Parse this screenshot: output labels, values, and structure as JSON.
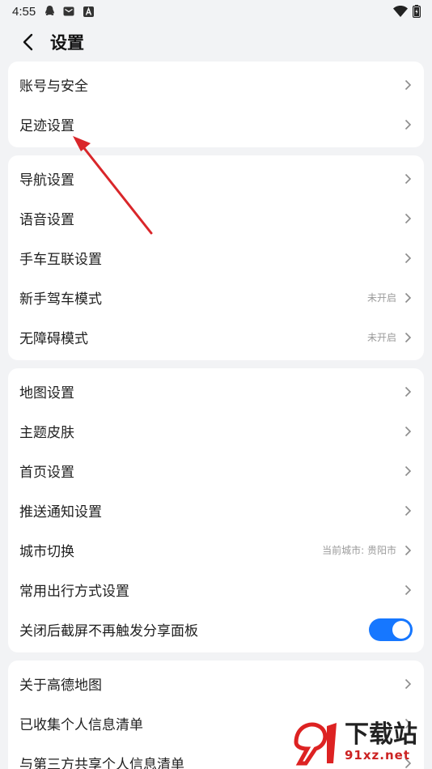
{
  "status_bar": {
    "time": "4:55",
    "icons_left": [
      "qq-icon",
      "mail-icon",
      "a-app-icon"
    ],
    "icons_right": [
      "wifi-icon",
      "battery-icon"
    ]
  },
  "header": {
    "title": "设置"
  },
  "groups": [
    {
      "rows": [
        {
          "label": "账号与安全",
          "value": ""
        },
        {
          "label": "足迹设置",
          "value": ""
        }
      ]
    },
    {
      "rows": [
        {
          "label": "导航设置",
          "value": ""
        },
        {
          "label": "语音设置",
          "value": ""
        },
        {
          "label": "手车互联设置",
          "value": ""
        },
        {
          "label": "新手驾车模式",
          "value": "未开启"
        },
        {
          "label": "无障碍模式",
          "value": "未开启"
        }
      ]
    },
    {
      "rows": [
        {
          "label": "地图设置",
          "value": ""
        },
        {
          "label": "主题皮肤",
          "value": ""
        },
        {
          "label": "首页设置",
          "value": ""
        },
        {
          "label": "推送通知设置",
          "value": ""
        },
        {
          "label": "城市切换",
          "value": "当前城市: 贵阳市"
        },
        {
          "label": "常用出行方式设置",
          "value": ""
        },
        {
          "label": "关闭后截屏不再触发分享面板",
          "toggle": true
        }
      ]
    },
    {
      "rows": [
        {
          "label": "关于高德地图",
          "value": ""
        },
        {
          "label": "已收集个人信息清单",
          "value": ""
        },
        {
          "label": "与第三方共享个人信息清单",
          "value": ""
        }
      ]
    }
  ],
  "colors": {
    "accent": "#1677ff",
    "annotation_arrow": "#d9262a",
    "background": "#f2f3f5"
  },
  "watermark": {
    "brand": "下载站",
    "domain": "91xz.net"
  }
}
